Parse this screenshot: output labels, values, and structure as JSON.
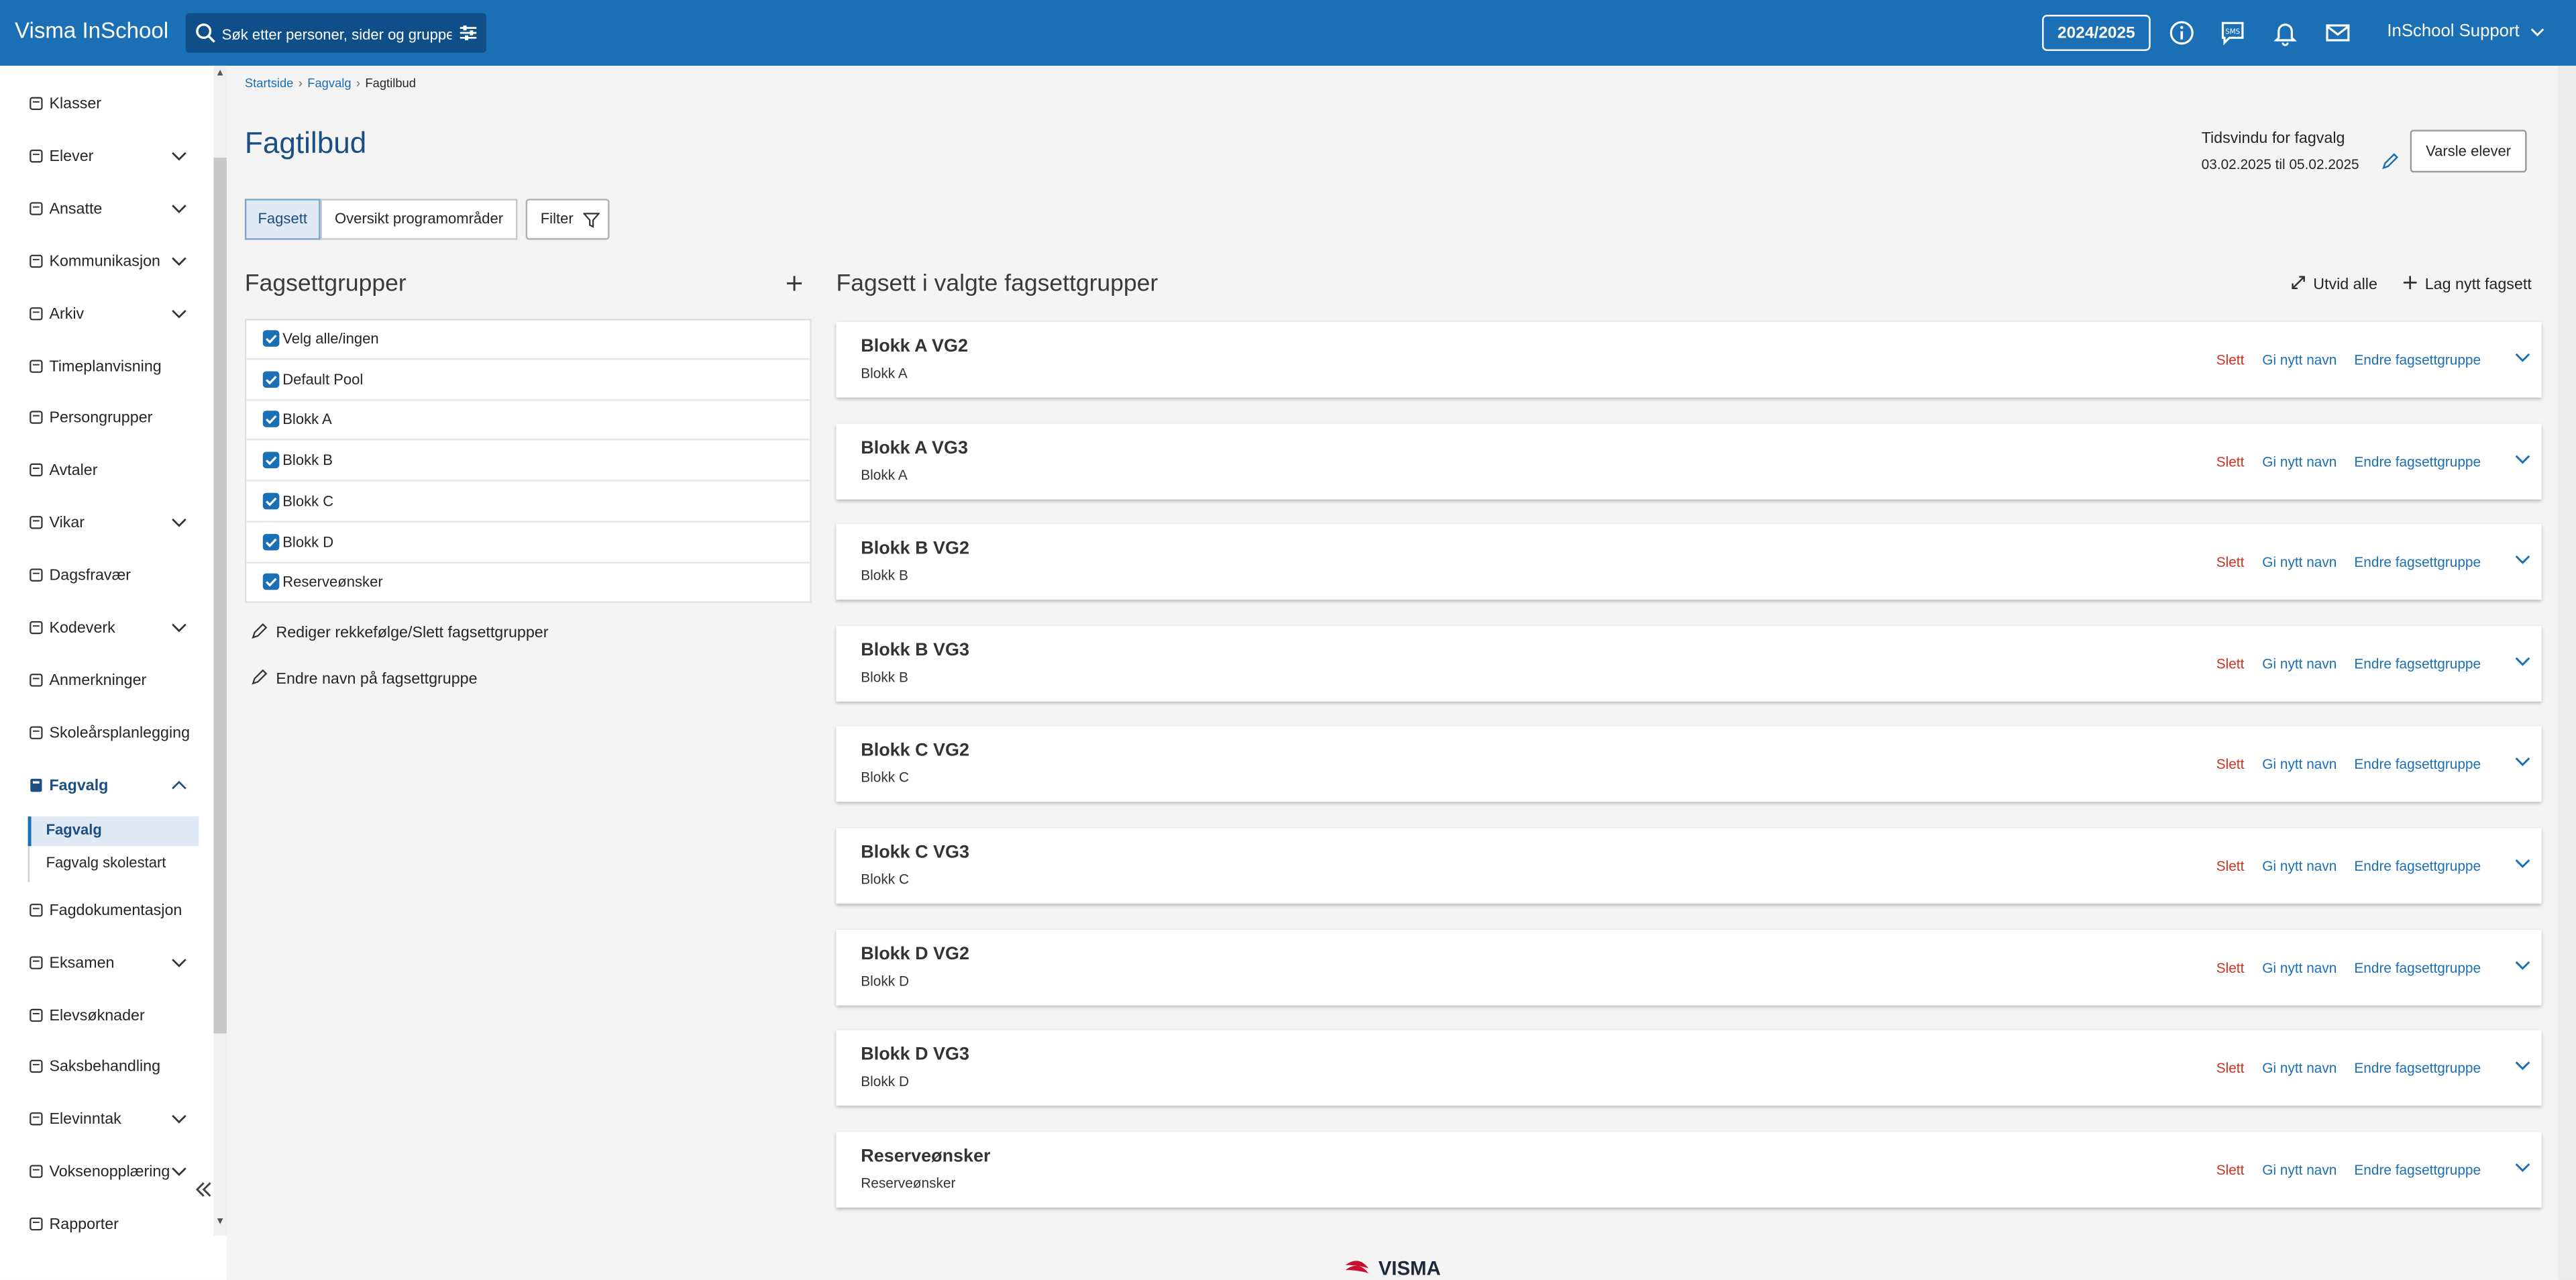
{
  "topbar": {
    "brand": "Visma InSchool",
    "search_placeholder": "Søk etter personer, sider og grupper",
    "year": "2024/2025",
    "user": "InSchool Support"
  },
  "sidebar": {
    "items": [
      {
        "label": "Klasser"
      },
      {
        "label": "Elever"
      },
      {
        "label": "Ansatte"
      },
      {
        "label": "Kommunikasjon"
      },
      {
        "label": "Arkiv"
      },
      {
        "label": "Timeplanvisning"
      },
      {
        "label": "Persongrupper"
      },
      {
        "label": "Avtaler"
      },
      {
        "label": "Vikar"
      },
      {
        "label": "Dagsfravær"
      },
      {
        "label": "Kodeverk"
      },
      {
        "label": "Anmerkninger"
      },
      {
        "label": "Skoleårsplanlegging"
      },
      {
        "label": "Fagvalg"
      },
      {
        "label": "Fagdokumentasjon"
      },
      {
        "label": "Eksamen"
      },
      {
        "label": "Elevsøknader"
      },
      {
        "label": "Saksbehandling"
      },
      {
        "label": "Elevinntak"
      },
      {
        "label": "Voksenopplæring"
      },
      {
        "label": "Rapporter"
      }
    ],
    "sub_items": [
      {
        "label": "Fagvalg"
      },
      {
        "label": "Fagvalg skolestart"
      }
    ]
  },
  "breadcrumb": [
    "Startside",
    "Fagvalg",
    "Fagtilbud"
  ],
  "page": {
    "title": "Fagtilbud",
    "tidsvindu_label": "Tidsvindu for fagvalg",
    "tidsvindu_value": "03.02.2025 til 05.02.2025",
    "varsle_button": "Varsle elever"
  },
  "tabs": [
    "Fagsett",
    "Oversikt programområder"
  ],
  "filter_button": "Filter",
  "left": {
    "heading": "Fagsettgrupper",
    "groups": [
      "Velg alle/ingen",
      "Default Pool",
      "Blokk A",
      "Blokk B",
      "Blokk C",
      "Blokk D",
      "Reserveønsker"
    ],
    "link_reorder": "Rediger rekkefølge/Slett fagsettgrupper",
    "link_rename": "Endre navn på fagsettgruppe"
  },
  "right": {
    "heading": "Fagsett i valgte fagsettgrupper",
    "expand_all": "Utvid alle",
    "new_set": "Lag nytt fagsett",
    "action_delete": "Slett",
    "action_rename": "Gi nytt navn",
    "action_change_group": "Endre fagsettgruppe",
    "cards": [
      {
        "title": "Blokk A VG2",
        "group": "Blokk A"
      },
      {
        "title": "Blokk A VG3",
        "group": "Blokk A"
      },
      {
        "title": "Blokk B VG2",
        "group": "Blokk B"
      },
      {
        "title": "Blokk B VG3",
        "group": "Blokk B"
      },
      {
        "title": "Blokk C VG2",
        "group": "Blokk C"
      },
      {
        "title": "Blokk C VG3",
        "group": "Blokk C"
      },
      {
        "title": "Blokk D VG2",
        "group": "Blokk D"
      },
      {
        "title": "Blokk D VG3",
        "group": "Blokk D"
      },
      {
        "title": "Reserveønsker",
        "group": "Reserveønsker"
      }
    ]
  },
  "footer_logo": "VISMA",
  "colors": {
    "brand_blue": "#1b6fb5",
    "delete_red": "#d2311f",
    "title_blue": "#1b4f82"
  }
}
